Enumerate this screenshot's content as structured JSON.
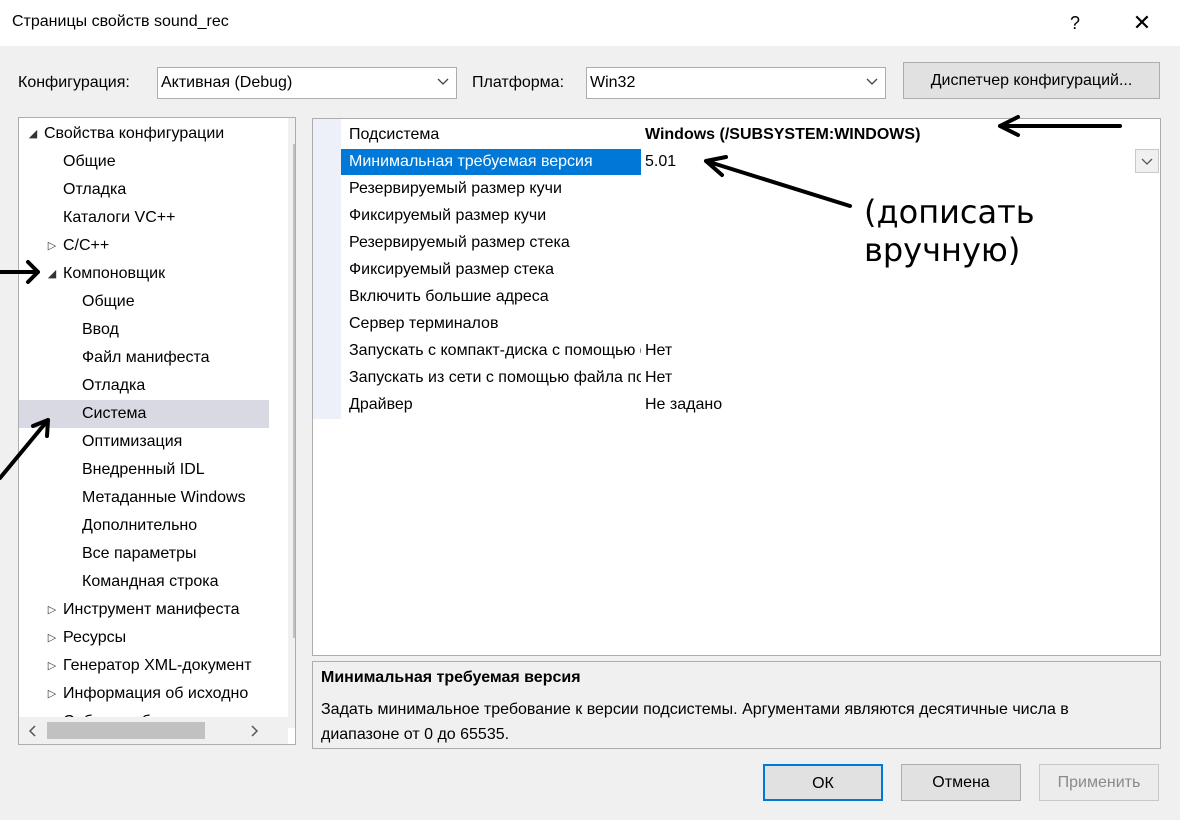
{
  "window": {
    "title": "Страницы свойств sound_rec",
    "help_glyph": "?",
    "close_glyph": "✕"
  },
  "toolbar": {
    "config_label": "Конфигурация:",
    "config_value": "Активная (Debug)",
    "platform_label": "Платформа:",
    "platform_value": "Win32",
    "config_manager_button": "Диспетчер конфигураций..."
  },
  "tree": {
    "items": [
      {
        "label": "Свойства конфигурации",
        "level": 0,
        "state": "expanded"
      },
      {
        "label": "Общие",
        "level": 1,
        "state": "leaf"
      },
      {
        "label": "Отладка",
        "level": 1,
        "state": "leaf"
      },
      {
        "label": "Каталоги VC++",
        "level": 1,
        "state": "leaf"
      },
      {
        "label": "C/C++",
        "level": 1,
        "state": "collapsed"
      },
      {
        "label": "Компоновщик",
        "level": 1,
        "state": "expanded"
      },
      {
        "label": "Общие",
        "level": 2,
        "state": "leaf"
      },
      {
        "label": "Ввод",
        "level": 2,
        "state": "leaf"
      },
      {
        "label": "Файл манифеста",
        "level": 2,
        "state": "leaf"
      },
      {
        "label": "Отладка",
        "level": 2,
        "state": "leaf"
      },
      {
        "label": "Система",
        "level": 2,
        "state": "leaf",
        "selected": true
      },
      {
        "label": "Оптимизация",
        "level": 2,
        "state": "leaf"
      },
      {
        "label": "Внедренный IDL",
        "level": 2,
        "state": "leaf"
      },
      {
        "label": "Метаданные Windows",
        "level": 2,
        "state": "leaf"
      },
      {
        "label": "Дополнительно",
        "level": 2,
        "state": "leaf"
      },
      {
        "label": "Все параметры",
        "level": 2,
        "state": "leaf"
      },
      {
        "label": "Командная строка",
        "level": 2,
        "state": "leaf"
      },
      {
        "label": "Инструмент манифеста",
        "level": 1,
        "state": "collapsed"
      },
      {
        "label": "Ресурсы",
        "level": 1,
        "state": "collapsed"
      },
      {
        "label": "Генератор XML-документ",
        "level": 1,
        "state": "collapsed"
      },
      {
        "label": "Информация об исходно",
        "level": 1,
        "state": "collapsed"
      },
      {
        "label": "События сборки",
        "level": 1,
        "state": "collapsed"
      }
    ]
  },
  "properties": [
    {
      "name": "Подсистема",
      "value": "Windows (/SUBSYSTEM:WINDOWS)",
      "bold": true
    },
    {
      "name": "Минимальная требуемая версия",
      "value": "5.01",
      "selected": true
    },
    {
      "name": "Резервируемый размер кучи",
      "value": ""
    },
    {
      "name": "Фиксируемый размер кучи",
      "value": ""
    },
    {
      "name": "Резервируемый размер стека",
      "value": ""
    },
    {
      "name": "Фиксируемый размер стека",
      "value": ""
    },
    {
      "name": "Включить большие адреса",
      "value": ""
    },
    {
      "name": "Сервер терминалов",
      "value": ""
    },
    {
      "name": "Запускать с компакт-диска с помощью файла подкачки",
      "value": "Нет"
    },
    {
      "name": "Запускать из сети с помощью файла подкачки",
      "value": "Нет"
    },
    {
      "name": "Драйвер",
      "value": "Не задано"
    }
  ],
  "description": {
    "title": "Минимальная требуемая версия",
    "text": "Задать минимальное требование к версии подсистемы. Аргументами являются десятичные числа в диапазоне от 0 до 65535."
  },
  "buttons": {
    "ok": "ОК",
    "cancel": "Отмена",
    "apply": "Применить"
  },
  "annotation": {
    "text": "(дописать вручную)"
  },
  "colors": {
    "selection": "#0078d7",
    "tree_selection": "#d9d9e3",
    "grid_margin": "#eef0f9"
  }
}
